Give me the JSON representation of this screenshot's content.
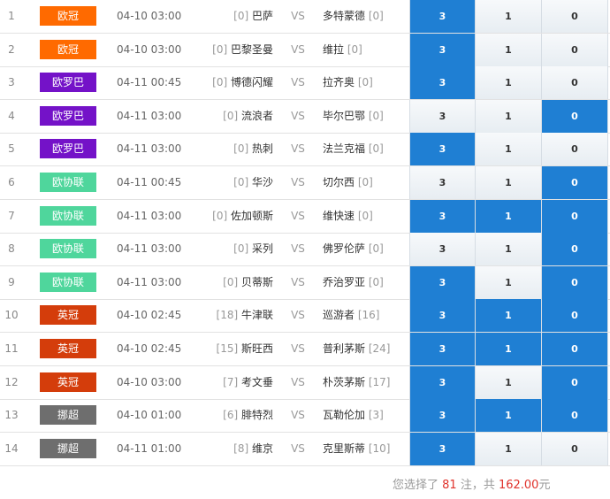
{
  "matches": [
    {
      "no": "1",
      "league": "欧冠",
      "league_color": "#ff6a00",
      "time": "04-10 03:00",
      "home_rank": "[0]",
      "home": "巴萨",
      "vs": "VS",
      "away": "多特蒙德",
      "away_rank": "[0]",
      "options": [
        {
          "label": "3",
          "selected": true
        },
        {
          "label": "1",
          "selected": false
        },
        {
          "label": "0",
          "selected": false
        }
      ]
    },
    {
      "no": "2",
      "league": "欧冠",
      "league_color": "#ff6a00",
      "time": "04-10 03:00",
      "home_rank": "[0]",
      "home": "巴黎圣曼",
      "vs": "VS",
      "away": "维拉",
      "away_rank": "[0]",
      "options": [
        {
          "label": "3",
          "selected": true
        },
        {
          "label": "1",
          "selected": false
        },
        {
          "label": "0",
          "selected": false
        }
      ]
    },
    {
      "no": "3",
      "league": "欧罗巴",
      "league_color": "#7412c8",
      "time": "04-11 00:45",
      "home_rank": "[0]",
      "home": "博德闪耀",
      "vs": "VS",
      "away": "拉齐奥",
      "away_rank": "[0]",
      "options": [
        {
          "label": "3",
          "selected": true
        },
        {
          "label": "1",
          "selected": false
        },
        {
          "label": "0",
          "selected": false
        }
      ]
    },
    {
      "no": "4",
      "league": "欧罗巴",
      "league_color": "#7412c8",
      "time": "04-11 03:00",
      "home_rank": "[0]",
      "home": "流浪者",
      "vs": "VS",
      "away": "毕尔巴鄂",
      "away_rank": "[0]",
      "options": [
        {
          "label": "3",
          "selected": false
        },
        {
          "label": "1",
          "selected": false
        },
        {
          "label": "0",
          "selected": true
        }
      ]
    },
    {
      "no": "5",
      "league": "欧罗巴",
      "league_color": "#7412c8",
      "time": "04-11 03:00",
      "home_rank": "[0]",
      "home": "热刺",
      "vs": "VS",
      "away": "法兰克福",
      "away_rank": "[0]",
      "options": [
        {
          "label": "3",
          "selected": true
        },
        {
          "label": "1",
          "selected": false
        },
        {
          "label": "0",
          "selected": false
        }
      ]
    },
    {
      "no": "6",
      "league": "欧协联",
      "league_color": "#4fd69c",
      "time": "04-11 00:45",
      "home_rank": "[0]",
      "home": "华沙",
      "vs": "VS",
      "away": "切尔西",
      "away_rank": "[0]",
      "options": [
        {
          "label": "3",
          "selected": false
        },
        {
          "label": "1",
          "selected": false
        },
        {
          "label": "0",
          "selected": true
        }
      ]
    },
    {
      "no": "7",
      "league": "欧协联",
      "league_color": "#4fd69c",
      "time": "04-11 03:00",
      "home_rank": "[0]",
      "home": "佐加顿斯",
      "vs": "VS",
      "away": "维快速",
      "away_rank": "[0]",
      "options": [
        {
          "label": "3",
          "selected": true
        },
        {
          "label": "1",
          "selected": true
        },
        {
          "label": "0",
          "selected": true
        }
      ]
    },
    {
      "no": "8",
      "league": "欧协联",
      "league_color": "#4fd69c",
      "time": "04-11 03:00",
      "home_rank": "[0]",
      "home": "采列",
      "vs": "VS",
      "away": "佛罗伦萨",
      "away_rank": "[0]",
      "options": [
        {
          "label": "3",
          "selected": false
        },
        {
          "label": "1",
          "selected": false
        },
        {
          "label": "0",
          "selected": true
        }
      ]
    },
    {
      "no": "9",
      "league": "欧协联",
      "league_color": "#4fd69c",
      "time": "04-11 03:00",
      "home_rank": "[0]",
      "home": "贝蒂斯",
      "vs": "VS",
      "away": "乔治罗亚",
      "away_rank": "[0]",
      "options": [
        {
          "label": "3",
          "selected": true
        },
        {
          "label": "1",
          "selected": false
        },
        {
          "label": "0",
          "selected": true
        }
      ]
    },
    {
      "no": "10",
      "league": "英冠",
      "league_color": "#d43d0b",
      "time": "04-10 02:45",
      "home_rank": "[18]",
      "home": "牛津联",
      "vs": "VS",
      "away": "巡游者",
      "away_rank": "[16]",
      "options": [
        {
          "label": "3",
          "selected": true
        },
        {
          "label": "1",
          "selected": true
        },
        {
          "label": "0",
          "selected": true
        }
      ]
    },
    {
      "no": "11",
      "league": "英冠",
      "league_color": "#d43d0b",
      "time": "04-10 02:45",
      "home_rank": "[15]",
      "home": "斯旺西",
      "vs": "VS",
      "away": "普利茅斯",
      "away_rank": "[24]",
      "options": [
        {
          "label": "3",
          "selected": true
        },
        {
          "label": "1",
          "selected": true
        },
        {
          "label": "0",
          "selected": true
        }
      ]
    },
    {
      "no": "12",
      "league": "英冠",
      "league_color": "#d43d0b",
      "time": "04-10 03:00",
      "home_rank": "[7]",
      "home": "考文垂",
      "vs": "VS",
      "away": "朴茨茅斯",
      "away_rank": "[17]",
      "options": [
        {
          "label": "3",
          "selected": true
        },
        {
          "label": "1",
          "selected": false
        },
        {
          "label": "0",
          "selected": true
        }
      ]
    },
    {
      "no": "13",
      "league": "挪超",
      "league_color": "#6e6e6e",
      "time": "04-10 01:00",
      "home_rank": "[6]",
      "home": "腓特烈",
      "vs": "VS",
      "away": "瓦勒伦加",
      "away_rank": "[3]",
      "options": [
        {
          "label": "3",
          "selected": true
        },
        {
          "label": "1",
          "selected": true
        },
        {
          "label": "0",
          "selected": true
        }
      ]
    },
    {
      "no": "14",
      "league": "挪超",
      "league_color": "#6e6e6e",
      "time": "04-11 01:00",
      "home_rank": "[8]",
      "home": "维京",
      "vs": "VS",
      "away": "克里斯蒂",
      "away_rank": "[10]",
      "options": [
        {
          "label": "3",
          "selected": true
        },
        {
          "label": "1",
          "selected": false
        },
        {
          "label": "0",
          "selected": false
        }
      ]
    }
  ],
  "summary": {
    "prefix": "您选择了 ",
    "count": "81",
    "middle": " 注，共 ",
    "amount": "162.00",
    "suffix": "元"
  }
}
